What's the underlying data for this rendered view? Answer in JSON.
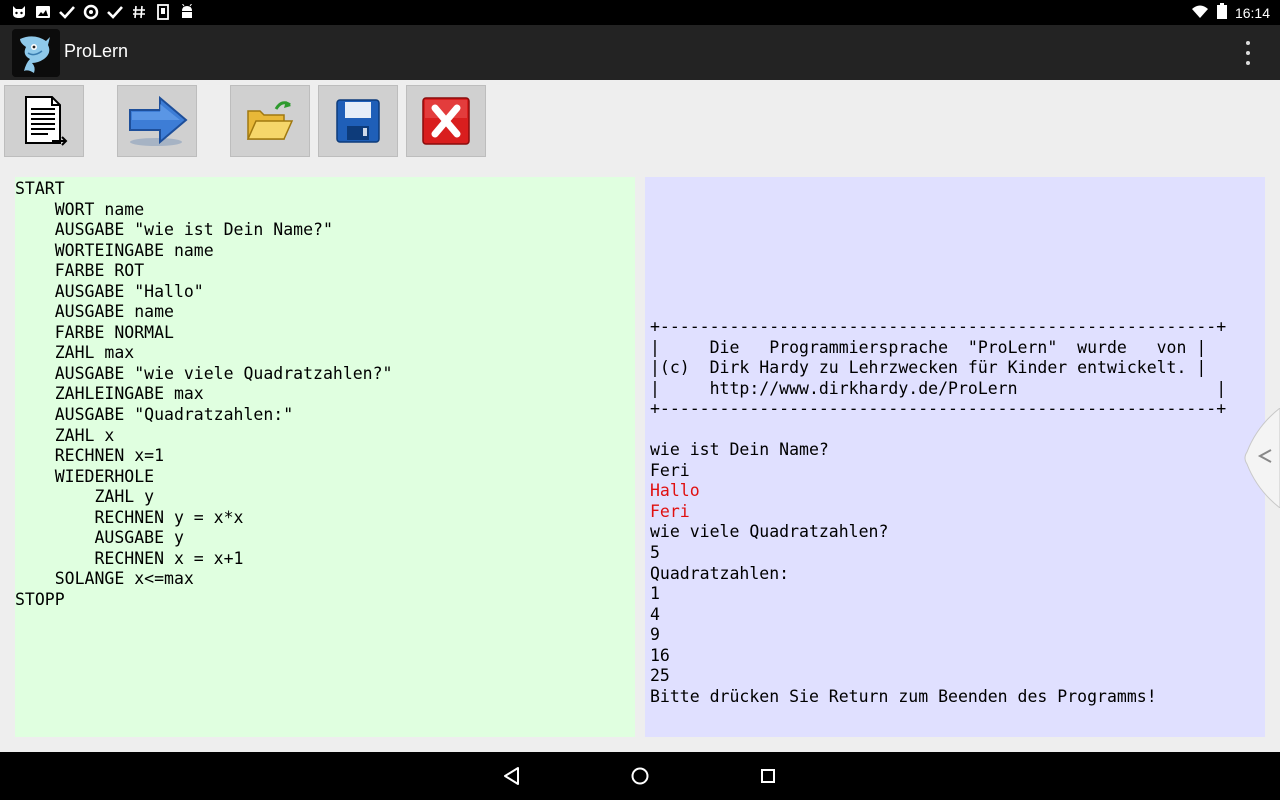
{
  "status_bar": {
    "left_icons": [
      "cat-icon",
      "image-icon",
      "check-icon",
      "sync-icon",
      "check-icon",
      "hashtag-icon",
      "sd-card-icon",
      "android-icon"
    ],
    "time": "16:14"
  },
  "action_bar": {
    "title": "ProLern",
    "overflow_icon": "more-vert-icon"
  },
  "toolbar": {
    "buttons": [
      {
        "name": "new-document-button",
        "icon": "document-icon"
      },
      {
        "name": "run-button",
        "icon": "arrow-right-icon"
      },
      {
        "name": "open-button",
        "icon": "folder-open-icon"
      },
      {
        "name": "save-button",
        "icon": "floppy-disk-icon"
      },
      {
        "name": "close-button",
        "icon": "red-x-icon"
      }
    ]
  },
  "editor": {
    "background": "#e0ffe0",
    "lines": [
      "START",
      "    WORT name",
      "    AUSGABE \"wie ist Dein Name?\"",
      "    WORTEINGABE name",
      "    FARBE ROT",
      "    AUSGABE \"Hallo\"",
      "    AUSGABE name",
      "    FARBE NORMAL",
      "    ZAHL max",
      "    AUSGABE \"wie viele Quadratzahlen?\"",
      "    ZAHLEINGABE max",
      "    AUSGABE \"Quadratzahlen:\"",
      "    ZAHL x",
      "    RECHNEN x=1",
      "    WIEDERHOLE",
      "        ZAHL y",
      "        RECHNEN y = x*x",
      "        AUSGABE y",
      "        RECHNEN x = x+1",
      "    SOLANGE x<=max",
      "STOPP"
    ]
  },
  "output": {
    "background": "#e0e0ff",
    "red_color": "#e01010",
    "lines": [
      {
        "text": "+--------------------------------------------------------+",
        "red": false
      },
      {
        "text": "|     Die   Programmiersprache  \"ProLern\"  wurde   von |",
        "red": false
      },
      {
        "text": "|(c)  Dirk Hardy zu Lehrzwecken für Kinder entwickelt. |",
        "red": false
      },
      {
        "text": "|     http://www.dirkhardy.de/ProLern                    |",
        "red": false
      },
      {
        "text": "+--------------------------------------------------------+",
        "red": false
      },
      {
        "text": "",
        "red": false
      },
      {
        "text": "wie ist Dein Name?",
        "red": false
      },
      {
        "text": "Feri",
        "red": false
      },
      {
        "text": "Hallo",
        "red": true
      },
      {
        "text": "Feri",
        "red": true
      },
      {
        "text": "wie viele Quadratzahlen?",
        "red": false
      },
      {
        "text": "5",
        "red": false
      },
      {
        "text": "Quadratzahlen:",
        "red": false
      },
      {
        "text": "1",
        "red": false
      },
      {
        "text": "4",
        "red": false
      },
      {
        "text": "9",
        "red": false
      },
      {
        "text": "16",
        "red": false
      },
      {
        "text": "25",
        "red": false
      },
      {
        "text": "Bitte drücken Sie Return zum Beenden des Programms!",
        "red": false
      }
    ]
  },
  "drawer_tab": {
    "icon": "chevron-left-icon"
  },
  "nav_bar": {
    "buttons": [
      {
        "name": "back-button",
        "icon": "back-triangle-icon"
      },
      {
        "name": "home-button",
        "icon": "home-circle-icon"
      },
      {
        "name": "recents-button",
        "icon": "recents-square-icon"
      }
    ]
  }
}
